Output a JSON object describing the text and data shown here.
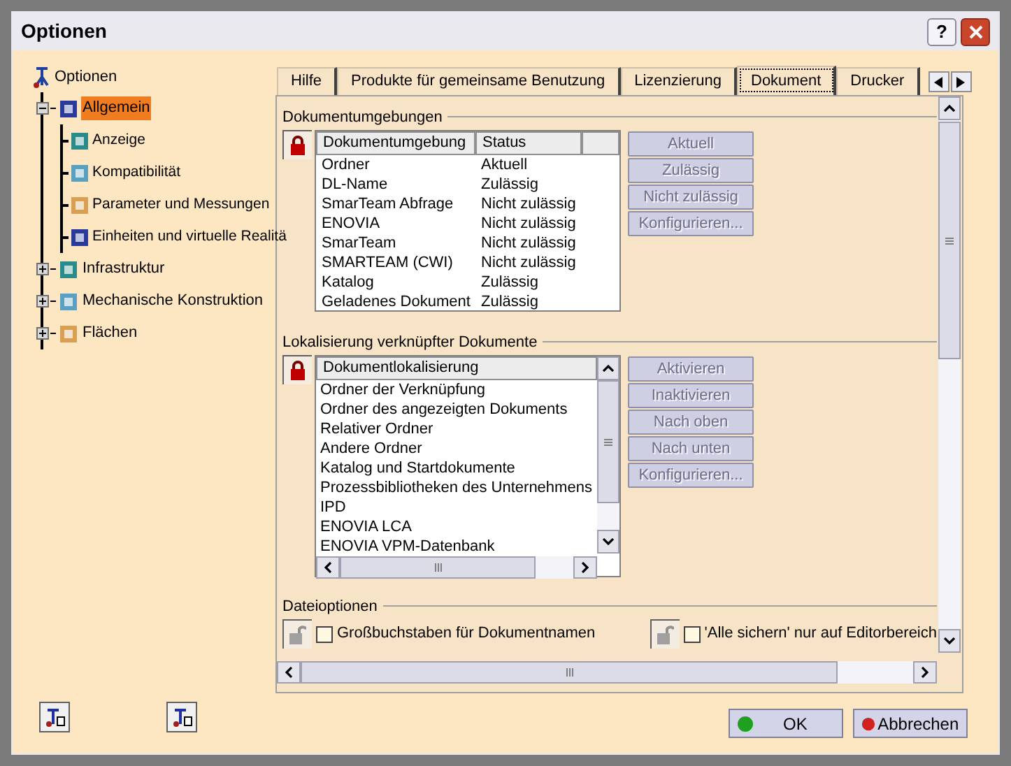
{
  "window": {
    "title": "Optionen",
    "help": "?"
  },
  "tree": {
    "label": "Optionen",
    "children": [
      {
        "label": "Allgemein",
        "selected": true,
        "expanded": true,
        "children": [
          {
            "label": "Anzeige",
            "selected": false
          },
          {
            "label": "Kompatibilität",
            "selected": false
          },
          {
            "label": "Parameter und Messungen",
            "selected": false
          },
          {
            "label": "Einheiten und virtuelle Realitä",
            "selected": false
          }
        ]
      },
      {
        "label": "Infrastruktur",
        "selected": false,
        "expanded": false
      },
      {
        "label": "Mechanische Konstruktion",
        "selected": false,
        "expanded": false
      },
      {
        "label": "Flächen",
        "selected": false,
        "expanded": false
      }
    ]
  },
  "tabs": [
    {
      "label": "Hilfe",
      "selected": false
    },
    {
      "label": "Produkte für gemeinsame Benutzung",
      "selected": false
    },
    {
      "label": "Lizenzierung",
      "selected": false
    },
    {
      "label": "Dokument",
      "selected": true
    },
    {
      "label": "Drucker",
      "selected": false
    }
  ],
  "document_environments": {
    "title": "Dokumentumgebungen",
    "columns": [
      "Dokumentumgebung",
      "Status"
    ],
    "rows": [
      [
        "Ordner",
        "Aktuell"
      ],
      [
        "DL-Name",
        "Zulässig"
      ],
      [
        "SmarTeam Abfrage",
        "Nicht zulässig"
      ],
      [
        "ENOVIA",
        "Nicht zulässig"
      ],
      [
        "SmarTeam",
        "Nicht zulässig"
      ],
      [
        "SMARTEAM (CWI)",
        "Nicht zulässig"
      ],
      [
        "Katalog",
        "Zulässig"
      ],
      [
        "Geladenes Dokument",
        "Zulässig"
      ]
    ],
    "buttons": [
      {
        "label": "Aktuell",
        "disabled": true
      },
      {
        "label": "Zulässig",
        "disabled": true
      },
      {
        "label": "Nicht zulässig",
        "disabled": true
      },
      {
        "label": "Konfigurieren...",
        "disabled": true
      }
    ]
  },
  "linked_documents": {
    "title": "Lokalisierung verknüpfter Dokumente",
    "column": "Dokumentlokalisierung",
    "items": [
      "Ordner der Verknüpfung",
      "Ordner des angezeigten Dokuments",
      "Relativer Ordner",
      "Andere Ordner",
      "Katalog und Startdokumente",
      "Prozessbibliotheken des Unternehmens",
      "IPD",
      "ENOVIA LCA",
      "ENOVIA VPM-Datenbank"
    ],
    "buttons": [
      {
        "label": "Aktivieren",
        "disabled": true
      },
      {
        "label": "Inaktivieren",
        "disabled": true
      },
      {
        "label": "Nach oben",
        "disabled": true
      },
      {
        "label": "Nach unten",
        "disabled": true
      },
      {
        "label": "Konfigurieren...",
        "disabled": true
      }
    ]
  },
  "file_options": {
    "title": "Dateioptionen",
    "options": [
      {
        "label": "Großbuchstaben für Dokumentnamen",
        "checked": false
      },
      {
        "label": "'Alle sichern' nur auf Editorbereich",
        "checked": false
      }
    ]
  },
  "footer": [
    {
      "label": "OK",
      "kind": "ok"
    },
    {
      "label": "Abbrechen",
      "kind": "cancel"
    }
  ]
}
